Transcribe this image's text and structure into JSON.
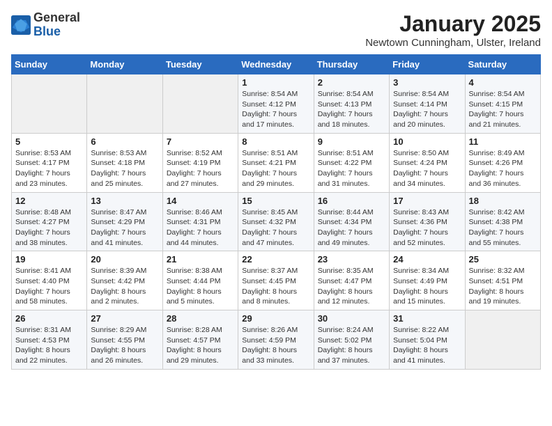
{
  "header": {
    "logo_general": "General",
    "logo_blue": "Blue",
    "month_title": "January 2025",
    "location": "Newtown Cunningham, Ulster, Ireland"
  },
  "weekdays": [
    "Sunday",
    "Monday",
    "Tuesday",
    "Wednesday",
    "Thursday",
    "Friday",
    "Saturday"
  ],
  "weeks": [
    [
      {
        "day": "",
        "info": ""
      },
      {
        "day": "",
        "info": ""
      },
      {
        "day": "",
        "info": ""
      },
      {
        "day": "1",
        "info": "Sunrise: 8:54 AM\nSunset: 4:12 PM\nDaylight: 7 hours\nand 17 minutes."
      },
      {
        "day": "2",
        "info": "Sunrise: 8:54 AM\nSunset: 4:13 PM\nDaylight: 7 hours\nand 18 minutes."
      },
      {
        "day": "3",
        "info": "Sunrise: 8:54 AM\nSunset: 4:14 PM\nDaylight: 7 hours\nand 20 minutes."
      },
      {
        "day": "4",
        "info": "Sunrise: 8:54 AM\nSunset: 4:15 PM\nDaylight: 7 hours\nand 21 minutes."
      }
    ],
    [
      {
        "day": "5",
        "info": "Sunrise: 8:53 AM\nSunset: 4:17 PM\nDaylight: 7 hours\nand 23 minutes."
      },
      {
        "day": "6",
        "info": "Sunrise: 8:53 AM\nSunset: 4:18 PM\nDaylight: 7 hours\nand 25 minutes."
      },
      {
        "day": "7",
        "info": "Sunrise: 8:52 AM\nSunset: 4:19 PM\nDaylight: 7 hours\nand 27 minutes."
      },
      {
        "day": "8",
        "info": "Sunrise: 8:51 AM\nSunset: 4:21 PM\nDaylight: 7 hours\nand 29 minutes."
      },
      {
        "day": "9",
        "info": "Sunrise: 8:51 AM\nSunset: 4:22 PM\nDaylight: 7 hours\nand 31 minutes."
      },
      {
        "day": "10",
        "info": "Sunrise: 8:50 AM\nSunset: 4:24 PM\nDaylight: 7 hours\nand 34 minutes."
      },
      {
        "day": "11",
        "info": "Sunrise: 8:49 AM\nSunset: 4:26 PM\nDaylight: 7 hours\nand 36 minutes."
      }
    ],
    [
      {
        "day": "12",
        "info": "Sunrise: 8:48 AM\nSunset: 4:27 PM\nDaylight: 7 hours\nand 38 minutes."
      },
      {
        "day": "13",
        "info": "Sunrise: 8:47 AM\nSunset: 4:29 PM\nDaylight: 7 hours\nand 41 minutes."
      },
      {
        "day": "14",
        "info": "Sunrise: 8:46 AM\nSunset: 4:31 PM\nDaylight: 7 hours\nand 44 minutes."
      },
      {
        "day": "15",
        "info": "Sunrise: 8:45 AM\nSunset: 4:32 PM\nDaylight: 7 hours\nand 47 minutes."
      },
      {
        "day": "16",
        "info": "Sunrise: 8:44 AM\nSunset: 4:34 PM\nDaylight: 7 hours\nand 49 minutes."
      },
      {
        "day": "17",
        "info": "Sunrise: 8:43 AM\nSunset: 4:36 PM\nDaylight: 7 hours\nand 52 minutes."
      },
      {
        "day": "18",
        "info": "Sunrise: 8:42 AM\nSunset: 4:38 PM\nDaylight: 7 hours\nand 55 minutes."
      }
    ],
    [
      {
        "day": "19",
        "info": "Sunrise: 8:41 AM\nSunset: 4:40 PM\nDaylight: 7 hours\nand 58 minutes."
      },
      {
        "day": "20",
        "info": "Sunrise: 8:39 AM\nSunset: 4:42 PM\nDaylight: 8 hours\nand 2 minutes."
      },
      {
        "day": "21",
        "info": "Sunrise: 8:38 AM\nSunset: 4:44 PM\nDaylight: 8 hours\nand 5 minutes."
      },
      {
        "day": "22",
        "info": "Sunrise: 8:37 AM\nSunset: 4:45 PM\nDaylight: 8 hours\nand 8 minutes."
      },
      {
        "day": "23",
        "info": "Sunrise: 8:35 AM\nSunset: 4:47 PM\nDaylight: 8 hours\nand 12 minutes."
      },
      {
        "day": "24",
        "info": "Sunrise: 8:34 AM\nSunset: 4:49 PM\nDaylight: 8 hours\nand 15 minutes."
      },
      {
        "day": "25",
        "info": "Sunrise: 8:32 AM\nSunset: 4:51 PM\nDaylight: 8 hours\nand 19 minutes."
      }
    ],
    [
      {
        "day": "26",
        "info": "Sunrise: 8:31 AM\nSunset: 4:53 PM\nDaylight: 8 hours\nand 22 minutes."
      },
      {
        "day": "27",
        "info": "Sunrise: 8:29 AM\nSunset: 4:55 PM\nDaylight: 8 hours\nand 26 minutes."
      },
      {
        "day": "28",
        "info": "Sunrise: 8:28 AM\nSunset: 4:57 PM\nDaylight: 8 hours\nand 29 minutes."
      },
      {
        "day": "29",
        "info": "Sunrise: 8:26 AM\nSunset: 4:59 PM\nDaylight: 8 hours\nand 33 minutes."
      },
      {
        "day": "30",
        "info": "Sunrise: 8:24 AM\nSunset: 5:02 PM\nDaylight: 8 hours\nand 37 minutes."
      },
      {
        "day": "31",
        "info": "Sunrise: 8:22 AM\nSunset: 5:04 PM\nDaylight: 8 hours\nand 41 minutes."
      },
      {
        "day": "",
        "info": ""
      }
    ]
  ]
}
